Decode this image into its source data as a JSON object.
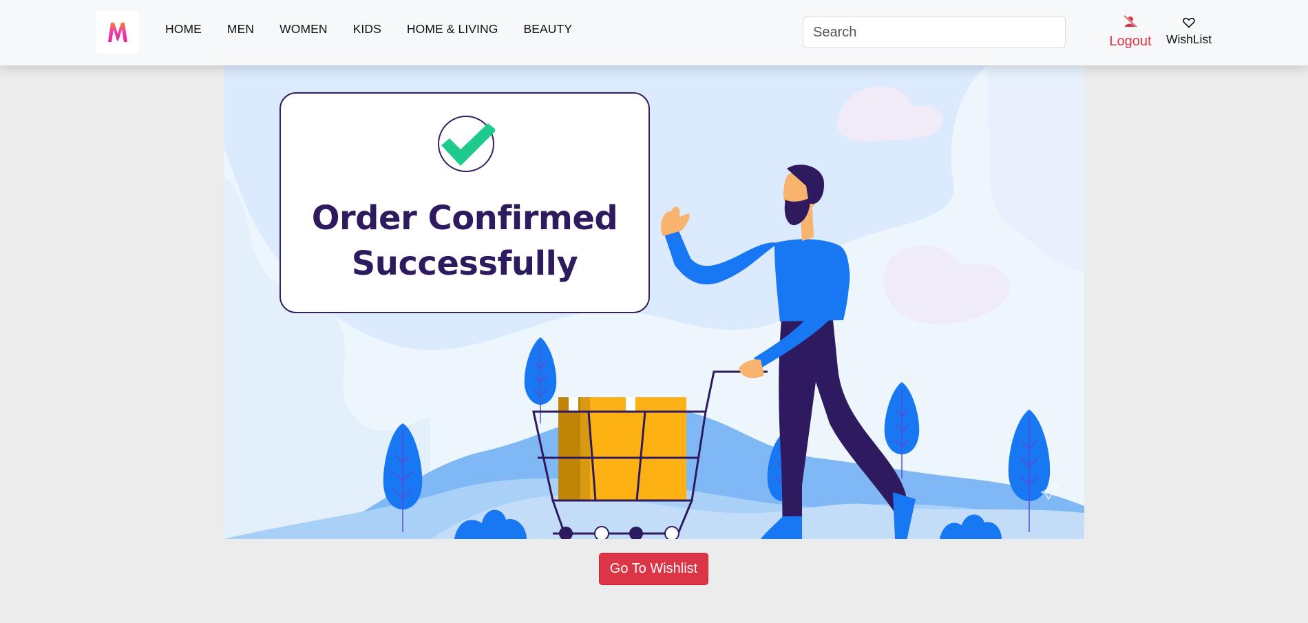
{
  "nav": {
    "links": [
      "HOME",
      "MEN",
      "WOMEN",
      "KIDS",
      "HOME & LIVING",
      "BEAUTY"
    ],
    "search_placeholder": "Search",
    "logout_label": "Logout",
    "wishlist_label": "WishList"
  },
  "hero": {
    "title": "Order Confirmed\nSuccessfully"
  },
  "cta": {
    "go_to_wishlist": "Go To Wishlist"
  },
  "colors": {
    "accent": "#dc3545",
    "brand_pink": "#f13ab1",
    "brand_orange": "#ff6a3d",
    "card_text": "#2e1a5e",
    "check_green": "#1ecb8c"
  }
}
